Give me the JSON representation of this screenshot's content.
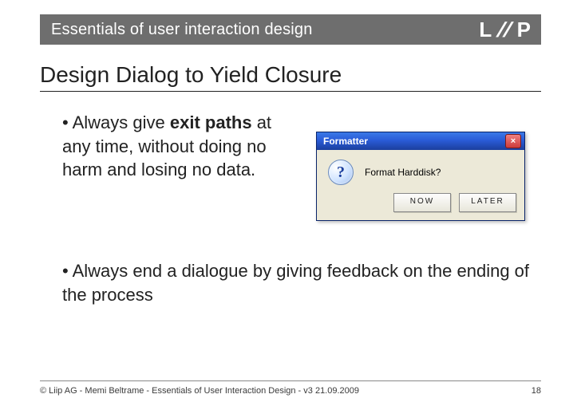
{
  "banner": {
    "title": "Essentials of user interaction design",
    "logo_left": "L",
    "logo_slashes": "//",
    "logo_right": "P"
  },
  "heading": "Design Dialog to Yield Closure",
  "bullets": {
    "b1_pre": "• Always give ",
    "b1_bold": "exit paths",
    "b1_post": " at any time, without doing no harm and losing no data.",
    "b2": "• Always end a dialogue by giving feedback on the ending of the process"
  },
  "dialog": {
    "title": "Formatter",
    "close_glyph": "×",
    "q_glyph": "?",
    "message": "Format Harddisk?",
    "btn_now": "NOW",
    "btn_later": "LATER"
  },
  "footer": {
    "credit": "© Liip AG - Memi Beltrame - Essentials of User Interaction Design - v3 21.09.2009",
    "page": "18"
  }
}
